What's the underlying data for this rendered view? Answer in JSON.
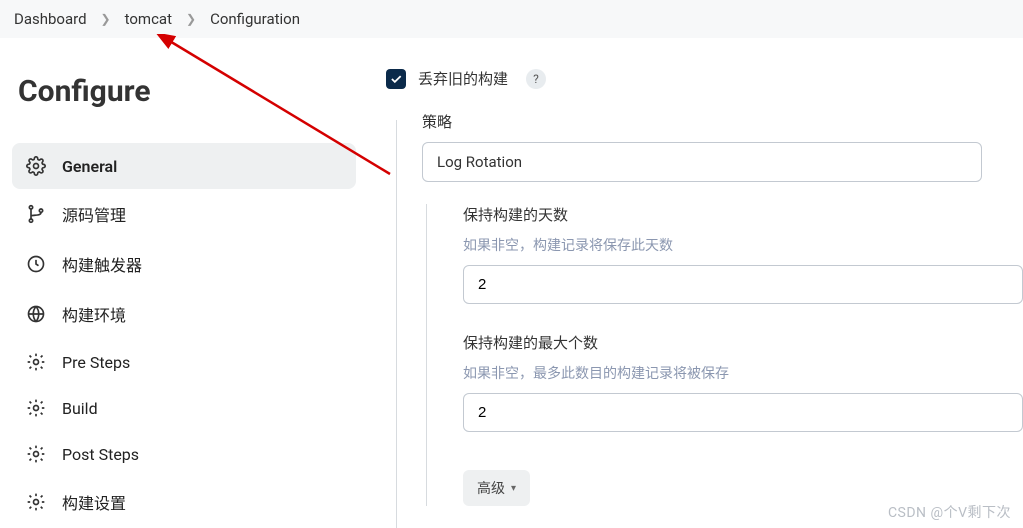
{
  "breadcrumb": {
    "items": [
      "Dashboard",
      "tomcat",
      "Configuration"
    ]
  },
  "page": {
    "title": "Configure"
  },
  "sidebar": {
    "items": [
      {
        "label": "General",
        "icon": "gear"
      },
      {
        "label": "源码管理",
        "icon": "branch"
      },
      {
        "label": "构建触发器",
        "icon": "clock"
      },
      {
        "label": "构建环境",
        "icon": "globe"
      },
      {
        "label": "Pre Steps",
        "icon": "gear"
      },
      {
        "label": "Build",
        "icon": "gear"
      },
      {
        "label": "Post Steps",
        "icon": "gear"
      },
      {
        "label": "构建设置",
        "icon": "gear"
      }
    ]
  },
  "form": {
    "discard": {
      "label": "丢弃旧的构建",
      "help": "?"
    },
    "strategy": {
      "label": "策略",
      "value": "Log Rotation"
    },
    "days": {
      "label": "保持构建的天数",
      "hint": "如果非空，构建记录将保存此天数",
      "value": "2"
    },
    "max": {
      "label": "保持构建的最大个数",
      "hint": "如果非空，最多此数目的构建记录将被保存",
      "value": "2"
    },
    "advanced": {
      "label": "高级"
    }
  },
  "watermark": "CSDN @个V剩下次"
}
